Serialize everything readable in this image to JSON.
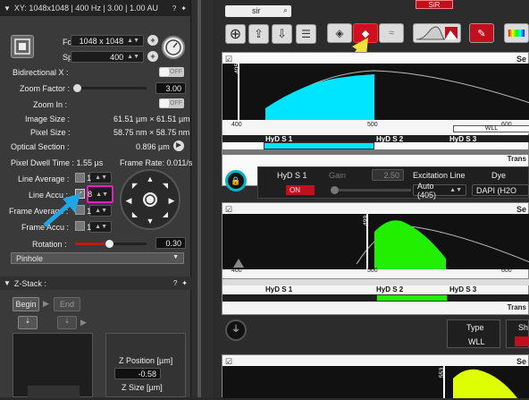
{
  "left_panel": {
    "header_title": "XY: 1048x1048 | 400 Hz | 3.00 | 1.00 AU",
    "format_label": "Format :",
    "format_value": "1048 x 1048",
    "speed_label": "Speed :",
    "speed_value": "400",
    "bidirectional_label": "Bidirectional X :",
    "bidirectional_value": "OFF",
    "zoom_factor_label": "Zoom Factor :",
    "zoom_factor_value": "3.00",
    "zoom_in_label": "Zoom In :",
    "zoom_in_value": "OFF",
    "image_size_label": "Image Size :",
    "image_size_value": "61.51 µm × 61.51 µm",
    "pixel_size_label": "Pixel Size :",
    "pixel_size_value": "58.75 nm × 58.75 nm",
    "optical_section_label": "Optical Section :",
    "optical_section_value": "0.896 µm",
    "pixel_dwell_label": "Pixel Dwell Time : 1.55 µs",
    "frame_rate_label": "Frame Rate: 0.011/s",
    "line_average_label": "Line Average :",
    "line_average_value": "1",
    "line_accu_label": "Line Accu :",
    "line_accu_value": "8",
    "frame_average_label": "Frame Average :",
    "frame_average_value": "1",
    "frame_accu_label": "Frame Accu :",
    "frame_accu_value": "1",
    "rotation_label": "Rotation :",
    "rotation_value": "0.30",
    "pinhole_label": "Pinhole",
    "zstack_title": "Z-Stack :",
    "begin_label": "Begin",
    "end_label": "End",
    "z_position_label": "Z Position [µm]",
    "z_position_value": "-0.58",
    "z_size_label": "Z Size [µm]"
  },
  "top": {
    "search_value": "sir",
    "channel_badge": "SiR"
  },
  "spectrum1": {
    "laser_label": "405",
    "ticks": [
      "400",
      "500",
      "600"
    ],
    "wll_label": "WLL",
    "detectors": [
      "HyD S 1",
      "HyD S 2",
      "HyD S 3"
    ],
    "corner_label": "Se",
    "trans_label": "Trans"
  },
  "detector_settings": {
    "detector_name": "HyD S 1",
    "gain_label": "Gain",
    "gain_value": "2.50",
    "on_label": "ON",
    "excitation_label": "Excitation Line",
    "excitation_value": "Auto (405)",
    "dye_label": "Dye",
    "dye_value": "DAPI (H2O"
  },
  "spectrum2": {
    "laser_label": "499",
    "ticks": [
      "400",
      "500",
      "600"
    ],
    "detectors": [
      "HyD S 1",
      "HyD S 2",
      "HyD S 3"
    ],
    "corner_label": "Se",
    "trans_label": "Trans"
  },
  "bottom": {
    "type_label": "Type",
    "type_value": "WLL",
    "sh_label": "Sh",
    "laser3_label": "553",
    "corner_label": "Se"
  },
  "colors": {
    "accent_cyan": "#00e5ff",
    "accent_green": "#22ee00",
    "accent_yellow": "#ddff00",
    "highlight_magenta": "#e020c0",
    "arrow_blue": "#1ea6e8",
    "arrow_yellow": "#f3e23a",
    "red": "#d01020"
  }
}
